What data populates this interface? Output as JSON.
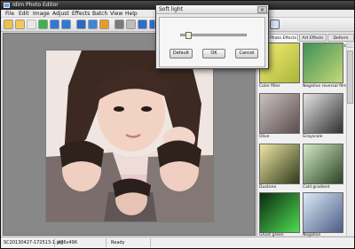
{
  "app": {
    "title": "Idim Photo Editor"
  },
  "menubar": {
    "items": [
      "File",
      "Edit",
      "Image",
      "Adjust",
      "Effects",
      "Batch",
      "View",
      "Help"
    ]
  },
  "effects_panel": {
    "tabs": [
      "Photo Effects",
      "Art Effects",
      "Deform Effects"
    ],
    "thumbs": [
      {
        "label": "Color filter",
        "style": "color-filter"
      },
      {
        "label": "Negative reversal film",
        "style": "negative-film"
      },
      {
        "label": "Olive",
        "style": "olive"
      },
      {
        "label": "Grayscale",
        "style": "grayscale"
      },
      {
        "label": "Duotone",
        "style": "duotone"
      },
      {
        "label": "Cold gradient",
        "style": "cold-gradient"
      },
      {
        "label": "Ghost green",
        "style": "ghost-green"
      },
      {
        "label": "Negative",
        "style": "negative"
      }
    ]
  },
  "statusbar": {
    "filename": "SC20130427-172513-1.jpg",
    "dimensions": "476x496",
    "status": "Ready"
  },
  "dialog": {
    "title": "Soft light",
    "slider_value_fraction": 0.08,
    "buttons": {
      "default": "Default",
      "ok": "OK",
      "cancel": "Cancel"
    }
  },
  "colors": {
    "canvas_bg": "#888888",
    "titlebar": "#2b2b2b",
    "panel_bg": "#f0f0f0"
  }
}
